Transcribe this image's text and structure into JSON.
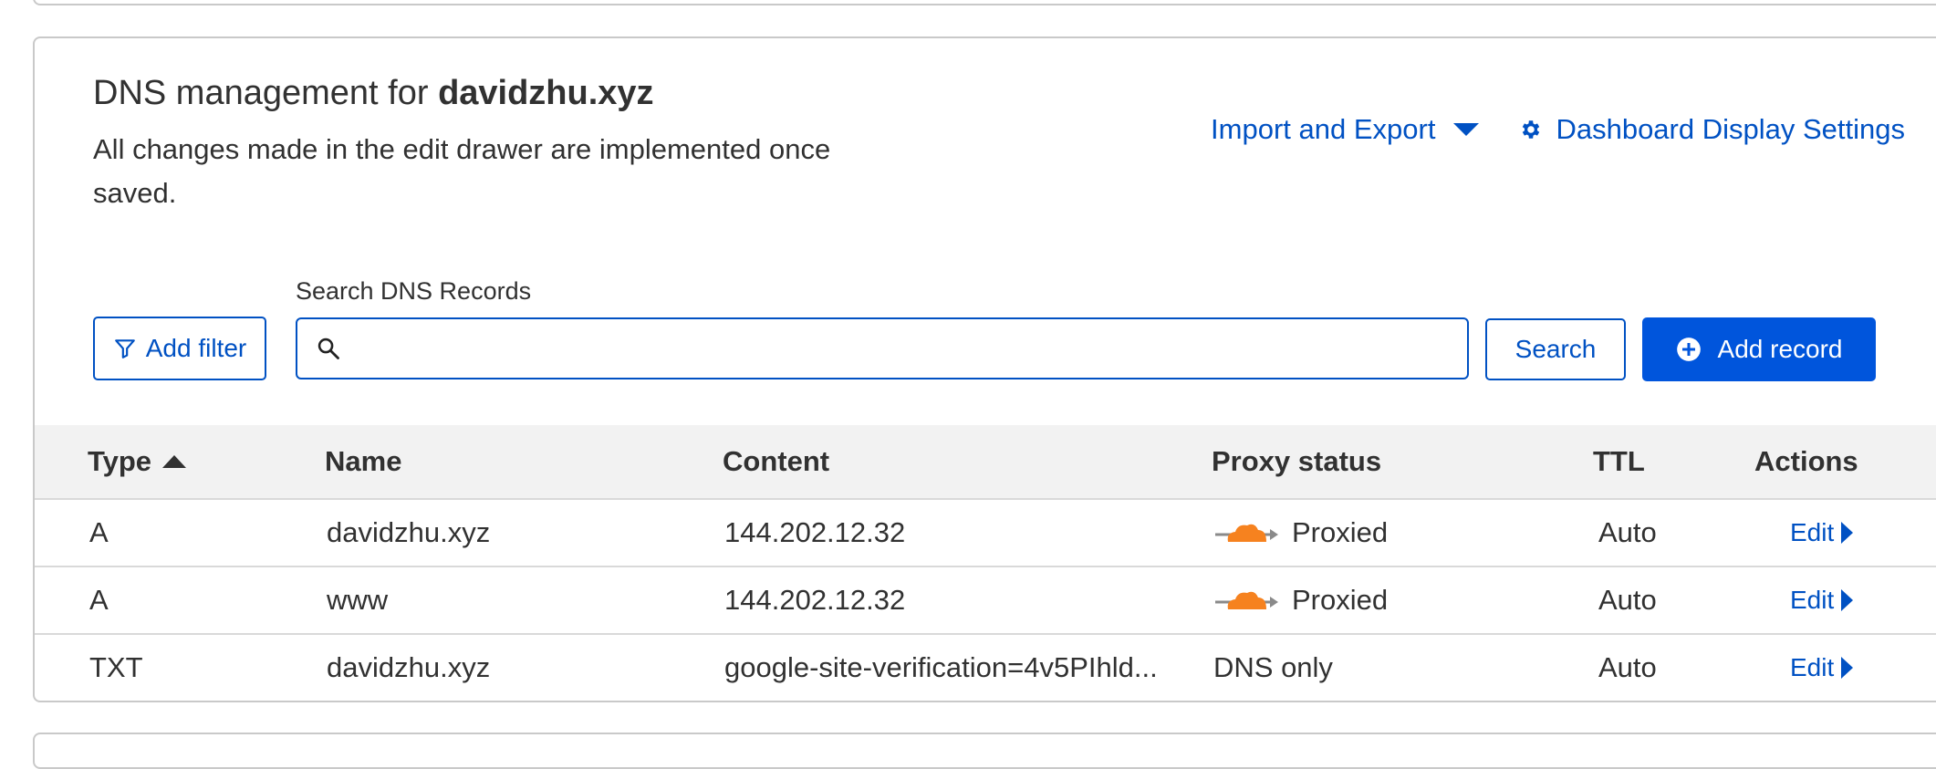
{
  "header": {
    "title_prefix": "DNS management for ",
    "domain": "davidzhu.xyz",
    "subtitle": "All changes made in the edit drawer are implemented once saved."
  },
  "links": {
    "import_export": "Import and Export",
    "dashboard_settings": "Dashboard Display Settings"
  },
  "toolbar": {
    "add_filter": "Add filter",
    "search_label": "Search DNS Records",
    "search_value": "",
    "search_button": "Search",
    "add_record": "Add record"
  },
  "table": {
    "columns": {
      "type": "Type",
      "name": "Name",
      "content": "Content",
      "proxy": "Proxy status",
      "ttl": "TTL",
      "actions": "Actions"
    },
    "sort": {
      "column": "Type",
      "direction": "ascending"
    },
    "rows": [
      {
        "type": "A",
        "name": "davidzhu.xyz",
        "content": "144.202.12.32",
        "proxy": "Proxied",
        "proxied": true,
        "ttl": "Auto",
        "action": "Edit"
      },
      {
        "type": "A",
        "name": "www",
        "content": "144.202.12.32",
        "proxy": "Proxied",
        "proxied": true,
        "ttl": "Auto",
        "action": "Edit"
      },
      {
        "type": "TXT",
        "name": "davidzhu.xyz",
        "content": "google-site-verification=4v5PIhld...",
        "proxy": "DNS only",
        "proxied": false,
        "ttl": "Auto",
        "action": "Edit"
      }
    ]
  },
  "icons": {
    "proxied": "orange-cloud-icon",
    "filter": "funnel-icon",
    "search": "magnifier-icon",
    "settings": "gear-icon",
    "add": "plus-circle-icon"
  },
  "colors": {
    "link": "#0051c3",
    "primary_button": "#0055dc",
    "cloud": "#f6821f",
    "header_bg": "#f2f2f2"
  }
}
